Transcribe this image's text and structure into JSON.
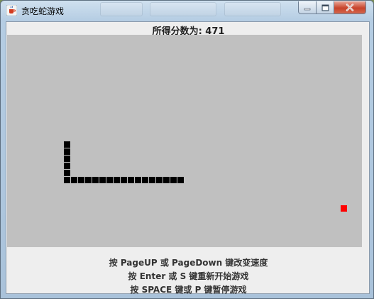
{
  "window": {
    "title": "贪吃蛇游戏",
    "app_icon": "java-coffee-cup-icon",
    "controls": [
      "minimize-icon",
      "maximize-icon",
      "close-icon"
    ]
  },
  "score": {
    "text": "所得分数为: 471",
    "value": 471
  },
  "board": {
    "background": "#c0c0c0",
    "snake_color": "#000000",
    "food_color": "#ff0000",
    "grid_size": [
      50,
      30
    ],
    "snake_cells": [
      [
        8,
        15
      ],
      [
        8,
        16
      ],
      [
        8,
        17
      ],
      [
        8,
        18
      ],
      [
        8,
        19
      ],
      [
        8,
        20
      ],
      [
        9,
        20
      ],
      [
        10,
        20
      ],
      [
        11,
        20
      ],
      [
        12,
        20
      ],
      [
        13,
        20
      ],
      [
        14,
        20
      ],
      [
        15,
        20
      ],
      [
        16,
        20
      ],
      [
        17,
        20
      ],
      [
        18,
        20
      ],
      [
        19,
        20
      ],
      [
        20,
        20
      ],
      [
        21,
        20
      ],
      [
        22,
        20
      ],
      [
        23,
        20
      ],
      [
        24,
        20
      ]
    ],
    "food_cell": [
      47,
      24
    ]
  },
  "instructions": {
    "line1": "按 PageUP 或 PageDown 键改变速度",
    "line2": "按 Enter 或 S 键重新开始游戏",
    "line3": "按 SPACE 键或 P 键暂停游戏"
  }
}
